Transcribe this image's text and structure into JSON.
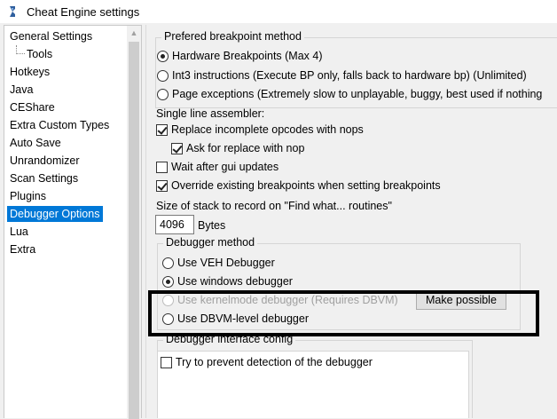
{
  "window": {
    "title": "Cheat Engine settings",
    "icon": "cheat-engine-icon"
  },
  "sidebar": {
    "items": [
      {
        "label": "General Settings",
        "child": false,
        "selected": false
      },
      {
        "label": "Tools",
        "child": true,
        "selected": false
      },
      {
        "label": "Hotkeys",
        "child": false,
        "selected": false
      },
      {
        "label": "Java",
        "child": false,
        "selected": false
      },
      {
        "label": "CEShare",
        "child": false,
        "selected": false
      },
      {
        "label": "Extra Custom Types",
        "child": false,
        "selected": false
      },
      {
        "label": "Auto Save",
        "child": false,
        "selected": false
      },
      {
        "label": "Unrandomizer",
        "child": false,
        "selected": false
      },
      {
        "label": "Scan Settings",
        "child": false,
        "selected": false
      },
      {
        "label": "Plugins",
        "child": false,
        "selected": false
      },
      {
        "label": "Debugger Options",
        "child": false,
        "selected": true
      },
      {
        "label": "Lua",
        "child": false,
        "selected": false
      },
      {
        "label": "Extra",
        "child": false,
        "selected": false
      }
    ]
  },
  "breakpoint_method": {
    "title": "Prefered breakpoint method",
    "options": [
      {
        "label": "Hardware Breakpoints (Max 4)",
        "checked": true
      },
      {
        "label": "Int3 instructions (Execute BP only, falls back to hardware bp) (Unlimited)",
        "checked": false
      },
      {
        "label": "Page exceptions (Extremely slow to unplayable, buggy, best used if nothing",
        "checked": false
      }
    ]
  },
  "assembler": {
    "label": "Single line assembler:",
    "replace_nops": {
      "label": "Replace incomplete opcodes with nops",
      "checked": true
    },
    "ask_replace": {
      "label": "Ask for replace with nop",
      "checked": true
    }
  },
  "wait_gui": {
    "label": "Wait after gui updates",
    "checked": false
  },
  "override_bp": {
    "label": "Override existing breakpoints when setting breakpoints",
    "checked": true
  },
  "stack": {
    "label": "Size of stack to record on \"Find what... routines\"",
    "value": "4096",
    "unit": "Bytes"
  },
  "debugger_method": {
    "title": "Debugger method",
    "options": [
      {
        "label": "Use VEH Debugger",
        "checked": false,
        "disabled": false
      },
      {
        "label": "Use windows debugger",
        "checked": true,
        "disabled": false
      },
      {
        "label": "Use kernelmode debugger (Requires DBVM)",
        "checked": false,
        "disabled": true
      },
      {
        "label": "Use DBVM-level debugger",
        "checked": false,
        "disabled": false
      }
    ],
    "make_possible_label": "Make possible"
  },
  "interface_config": {
    "title": "Debugger interface config",
    "prevent_detection": {
      "label": "Try to prevent detection of the debugger",
      "checked": false
    }
  }
}
